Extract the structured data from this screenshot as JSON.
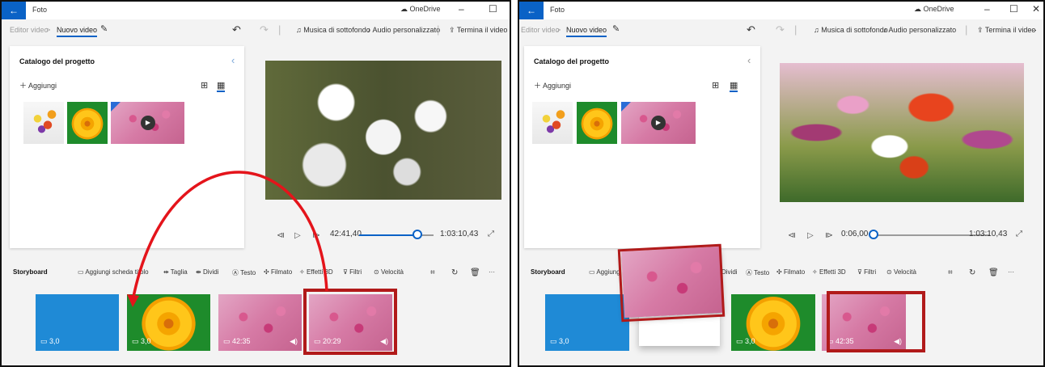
{
  "app": {
    "title": "Foto",
    "onedrive": "OneDrive",
    "minimize": "–",
    "maximize": "☐",
    "close": "✕"
  },
  "breadcrumb": {
    "parent": "Editor video",
    "current": "Nuovo video",
    "separator": ">"
  },
  "toolbar": {
    "music": "Musica di sottofondo",
    "custom_audio": "Audio personalizzato",
    "finish": "Termina il video",
    "more": "···"
  },
  "catalog": {
    "title": "Catalogo del progetto",
    "add": "Aggiungi"
  },
  "storyboard": {
    "title": "Storyboard",
    "add_title_card": "Aggiungi scheda titolo",
    "add_title_card_short": "Aggiungi",
    "trim": "Taglia",
    "split": "Dividi",
    "text": "Testo",
    "motion": "Filmato",
    "effects_3d": "Effetti 3D",
    "filters": "Filtri",
    "speed": "Velocità",
    "more": "···"
  },
  "left_panel": {
    "current_time": "42:41,40",
    "total_time": "1:03:10,43",
    "progress_fraction": 0.78,
    "clips": [
      {
        "duration": "3,0",
        "type": "title"
      },
      {
        "duration": "3,0",
        "type": "image"
      },
      {
        "duration": "42:35",
        "type": "video"
      },
      {
        "duration": "20:29",
        "type": "video"
      }
    ]
  },
  "right_panel": {
    "current_time": "0:06,00",
    "total_time": "1:03:10,43",
    "progress_fraction": 0.0,
    "clips": [
      {
        "duration": "3,0",
        "type": "title"
      },
      {
        "duration": "3,0",
        "type": "image"
      },
      {
        "duration": "42:35",
        "type": "video"
      }
    ]
  },
  "colors": {
    "accent": "#0a62c6",
    "highlight": "#b11a1a",
    "title_clip": "#1f8ad6",
    "arrow": "#e4141b"
  }
}
